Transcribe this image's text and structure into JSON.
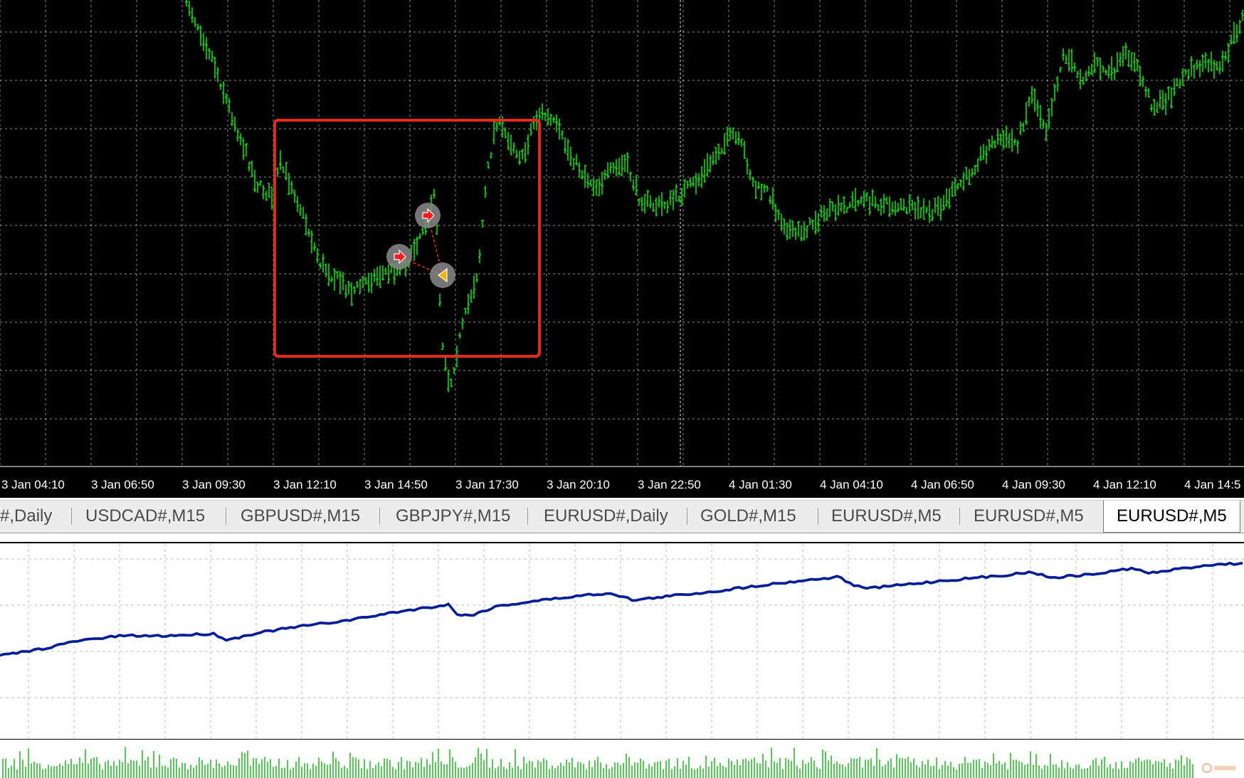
{
  "chart": {
    "symbol_series": "EURUSD#,M5",
    "colors": {
      "background": "#000000",
      "grid": "#ffffff",
      "price_bars": "#00e000",
      "highlight_box": "#e32b1f",
      "equity_line": "#0a1a9e",
      "volume_bars": "#1fb41f"
    },
    "trade_markers": [
      {
        "icon": "buy-arrow-icon"
      },
      {
        "icon": "buy-arrow-icon"
      },
      {
        "icon": "close-arrow-icon"
      }
    ]
  },
  "time_axis": {
    "labels": [
      "3 Jan 04:10",
      "3 Jan 06:50",
      "3 Jan 09:30",
      "3 Jan 12:10",
      "3 Jan 14:50",
      "3 Jan 17:30",
      "3 Jan 20:10",
      "3 Jan 22:50",
      "4 Jan 01:30",
      "4 Jan 04:10",
      "4 Jan 06:50",
      "4 Jan 09:30",
      "4 Jan 12:10",
      "4 Jan 14:5"
    ]
  },
  "tabs": [
    {
      "label": "#,Daily",
      "active": false
    },
    {
      "label": "USDCAD#,M15",
      "active": false
    },
    {
      "label": "GBPUSD#,M15",
      "active": false
    },
    {
      "label": "GBPJPY#,M15",
      "active": false
    },
    {
      "label": "EURUSD#,Daily",
      "active": false
    },
    {
      "label": "GOLD#,M15",
      "active": false
    },
    {
      "label": "EURUSD#,M5",
      "active": false
    },
    {
      "label": "EURUSD#,M5",
      "active": false
    },
    {
      "label": "EURUSD#,M5",
      "active": true
    }
  ]
}
